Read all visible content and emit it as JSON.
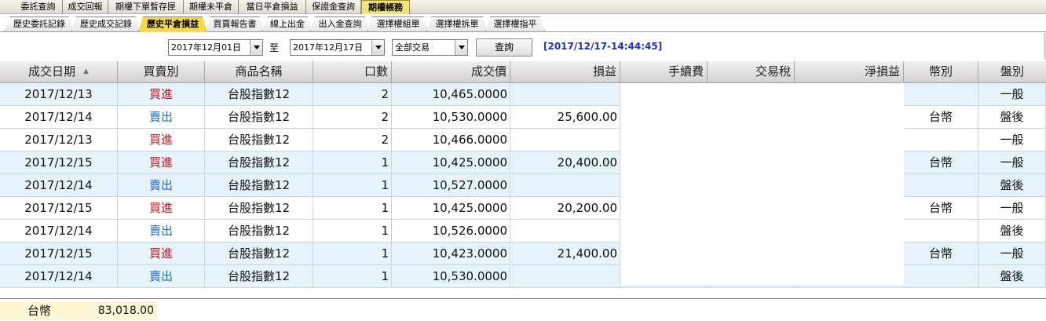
{
  "top_tabs": [
    {
      "label": "委託查詢",
      "active": false
    },
    {
      "label": "成交回報",
      "active": false
    },
    {
      "label": "期權下單暫存匣",
      "active": false
    },
    {
      "label": "期權未平倉",
      "active": false
    },
    {
      "label": "當日平倉損益",
      "active": false
    },
    {
      "label": "保證金查詢",
      "active": false
    },
    {
      "label": "期權帳務",
      "active": true
    }
  ],
  "sub_tabs": [
    {
      "label": "歷史委託記錄",
      "active": false
    },
    {
      "label": "歷史成交記錄",
      "active": false
    },
    {
      "label": "歷史平倉損益",
      "active": true
    },
    {
      "label": "買賣報告書",
      "active": false
    },
    {
      "label": "線上出金",
      "active": false
    },
    {
      "label": "出入金查詢",
      "active": false
    },
    {
      "label": "選擇權組單",
      "active": false
    },
    {
      "label": "選擇權拆單",
      "active": false
    },
    {
      "label": "選擇權指平",
      "active": false
    }
  ],
  "query": {
    "start_date": "2017年12月01日",
    "to_label": "至",
    "end_date": "2017年12月17日",
    "trade_type": "全部交易",
    "search_button": "查詢",
    "timestamp": "[2017/12/17-14:44:45]"
  },
  "table": {
    "columns": [
      "成交日期",
      "買賣別",
      "商品名稱",
      "口數",
      "成交價",
      "損益",
      "手續費",
      "交易稅",
      "淨損益",
      "幣別",
      "盤別"
    ],
    "sort_indicator": "▲",
    "rows": [
      {
        "date": "2017/12/13",
        "side": "買進",
        "product": "台股指數12",
        "qty": "2",
        "price": "10,465.0000",
        "pnl": "",
        "currency": "",
        "session": "一般"
      },
      {
        "date": "2017/12/14",
        "side": "賣出",
        "product": "台股指數12",
        "qty": "2",
        "price": "10,530.0000",
        "pnl": "25,600.00",
        "currency": "台幣",
        "session": "盤後"
      },
      {
        "date": "2017/12/13",
        "side": "買進",
        "product": "台股指數12",
        "qty": "2",
        "price": "10,466.0000",
        "pnl": "",
        "currency": "",
        "session": "一般"
      },
      {
        "date": "2017/12/15",
        "side": "買進",
        "product": "台股指數12",
        "qty": "1",
        "price": "10,425.0000",
        "pnl": "20,400.00",
        "currency": "台幣",
        "session": "一般"
      },
      {
        "date": "2017/12/14",
        "side": "賣出",
        "product": "台股指數12",
        "qty": "1",
        "price": "10,527.0000",
        "pnl": "",
        "currency": "",
        "session": "盤後"
      },
      {
        "date": "2017/12/15",
        "side": "買進",
        "product": "台股指數12",
        "qty": "1",
        "price": "10,425.0000",
        "pnl": "20,200.00",
        "currency": "台幣",
        "session": "一般"
      },
      {
        "date": "2017/12/14",
        "side": "賣出",
        "product": "台股指數12",
        "qty": "1",
        "price": "10,526.0000",
        "pnl": "",
        "currency": "",
        "session": "盤後"
      },
      {
        "date": "2017/12/15",
        "side": "買進",
        "product": "台股指數12",
        "qty": "1",
        "price": "10,423.0000",
        "pnl": "21,400.00",
        "currency": "台幣",
        "session": "一般"
      },
      {
        "date": "2017/12/14",
        "side": "賣出",
        "product": "台股指數12",
        "qty": "1",
        "price": "10,530.0000",
        "pnl": "",
        "currency": "",
        "session": "盤後"
      }
    ]
  },
  "summary": {
    "currency": "台幣",
    "total": "83,018.00"
  },
  "colors": {
    "buy": "#c4162a",
    "sell": "#1d6fc4",
    "row_alt": "#e6f3fa",
    "active_tab": "#f3d850",
    "timestamp": "#2030c0"
  },
  "icons": {
    "sort": "sort-ascending-icon",
    "dropdown": "chevron-down-icon"
  }
}
